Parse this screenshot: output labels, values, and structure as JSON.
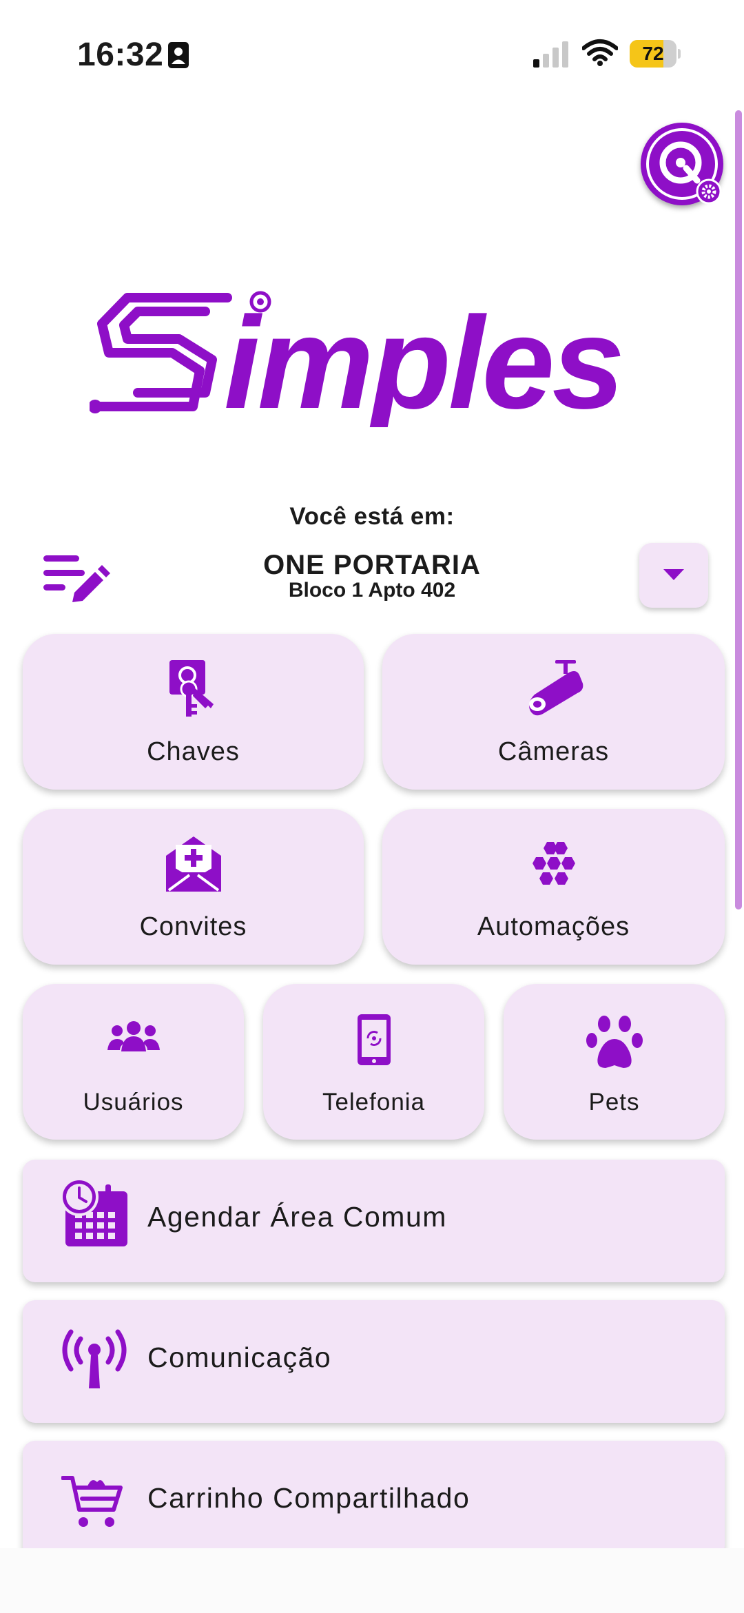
{
  "status_bar": {
    "time": "16:32",
    "battery_percent": "72",
    "battery_level": 0.72
  },
  "colors": {
    "accent": "#8e0fc7",
    "tile_bg": "#f3e4f7",
    "battery": "#f5c518"
  },
  "logo_text": "Simples",
  "location": {
    "caption": "Você está em:",
    "name": "ONE PORTARIA",
    "unit": "Bloco 1 Apto 402"
  },
  "tiles": {
    "chaves": {
      "label": "Chaves",
      "icon": "keys-icon"
    },
    "cameras": {
      "label": "Câmeras",
      "icon": "camera-icon"
    },
    "convites": {
      "label": "Convites",
      "icon": "invite-envelope-icon"
    },
    "automacoes": {
      "label": "Automações",
      "icon": "hexagons-icon"
    },
    "usuarios": {
      "label": "Usuários",
      "icon": "users-icon"
    },
    "telefonia": {
      "label": "Telefonia",
      "icon": "phone-tablet-icon"
    },
    "pets": {
      "label": "Pets",
      "icon": "paw-icon"
    }
  },
  "rows": {
    "agendar": {
      "label": "Agendar Área Comum",
      "icon": "calendar-clock-icon"
    },
    "comunicacao": {
      "label": "Comunicação",
      "icon": "antenna-icon"
    },
    "carrinho": {
      "label": "Carrinho Compartilhado",
      "icon": "cart-icon"
    }
  }
}
